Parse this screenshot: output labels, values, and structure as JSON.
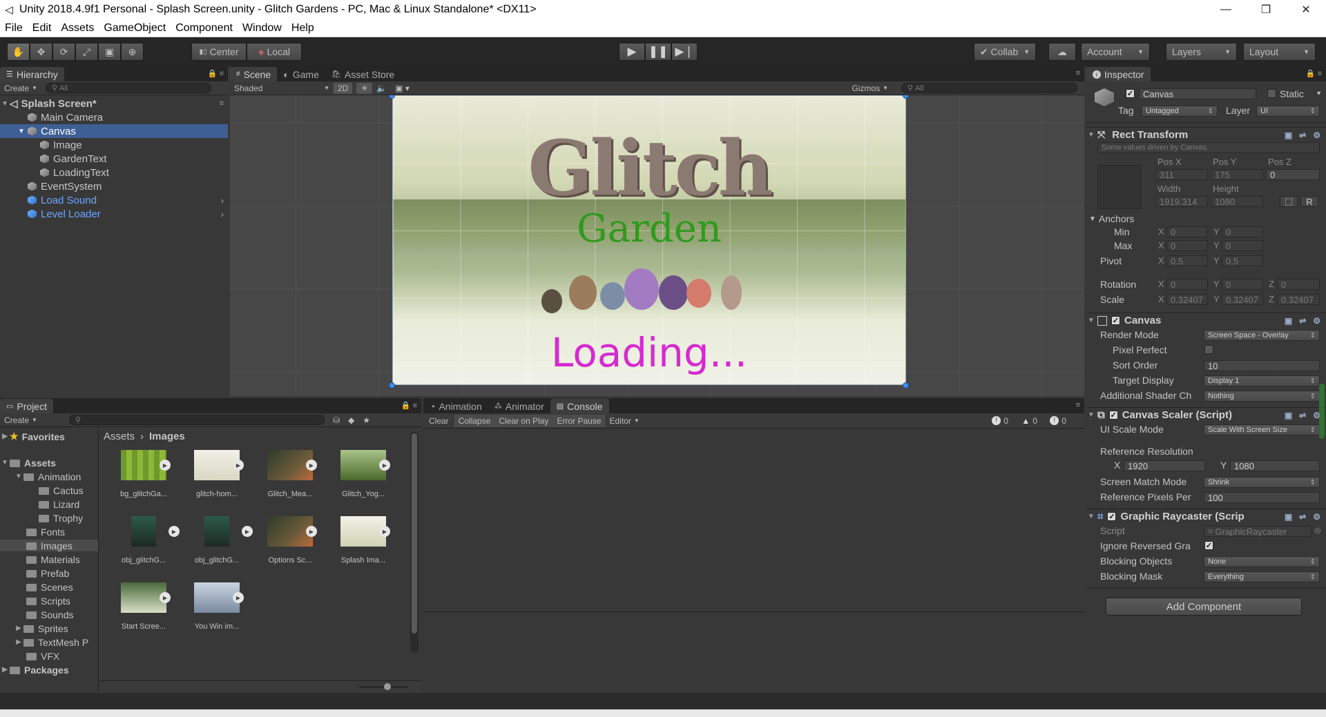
{
  "window": {
    "title": "Unity 2018.4.9f1 Personal - Splash Screen.unity - Glitch Gardens - PC, Mac & Linux Standalone* <DX11>",
    "minimize": "—",
    "restore": "❐",
    "close": "✕"
  },
  "menu": [
    "File",
    "Edit",
    "Assets",
    "GameObject",
    "Component",
    "Window",
    "Help"
  ],
  "toolbar": {
    "pivot": "Center",
    "space": "Local",
    "collab": "Collab",
    "account": "Account",
    "layers": "Layers",
    "layout": "Layout"
  },
  "hierarchy": {
    "tab": "Hierarchy",
    "create": "Create",
    "search_placeholder": "All",
    "scene": "Splash Screen*",
    "items": [
      {
        "label": "Main Camera"
      },
      {
        "label": "Canvas"
      },
      {
        "label": "Image"
      },
      {
        "label": "GardenText"
      },
      {
        "label": "LoadingText"
      },
      {
        "label": "EventSystem"
      },
      {
        "label": "Load Sound"
      },
      {
        "label": "Level Loader"
      }
    ]
  },
  "scene": {
    "tabs": [
      "Scene",
      "Game",
      "Asset Store"
    ],
    "shading": "Shaded",
    "mode_2d": "2D",
    "gizmos": "Gizmos",
    "search_placeholder": "All",
    "game_title": "Glitch",
    "game_subtitle": "Garden",
    "game_loading": "Loading..."
  },
  "project": {
    "tab": "Project",
    "create": "Create",
    "favorites": "Favorites",
    "tree": [
      {
        "label": "Assets"
      },
      {
        "label": "Animation"
      },
      {
        "label": "Cactus"
      },
      {
        "label": "Lizard"
      },
      {
        "label": "Trophy"
      },
      {
        "label": "Fonts"
      },
      {
        "label": "Images"
      },
      {
        "label": "Materials"
      },
      {
        "label": "Prefab"
      },
      {
        "label": "Scenes"
      },
      {
        "label": "Scripts"
      },
      {
        "label": "Sounds"
      },
      {
        "label": "Sprites"
      },
      {
        "label": "TextMesh P"
      },
      {
        "label": "VFX"
      },
      {
        "label": "Packages"
      }
    ],
    "breadcrumb_root": "Assets",
    "breadcrumb_current": "Images",
    "assets": [
      {
        "label": "bg_glitchGa..."
      },
      {
        "label": "glitch-hom..."
      },
      {
        "label": "Glitch_Mea..."
      },
      {
        "label": "Glitch_Yog..."
      },
      {
        "label": "obj_glitchG..."
      },
      {
        "label": "obj_glitchG..."
      },
      {
        "label": "Options Sc..."
      },
      {
        "label": "Splash Ima..."
      },
      {
        "label": "Start Scree..."
      },
      {
        "label": "You Win im..."
      }
    ]
  },
  "console": {
    "tabs": [
      "Animation",
      "Animator",
      "Console"
    ],
    "buttons": [
      "Clear",
      "Collapse",
      "Clear on Play",
      "Error Pause",
      "Editor"
    ],
    "counts": [
      "0",
      "0",
      "0"
    ]
  },
  "inspector": {
    "tab": "Inspector",
    "object_name": "Canvas",
    "static": "Static",
    "tag_label": "Tag",
    "tag": "Untagged",
    "layer_label": "Layer",
    "layer": "UI",
    "rect_transform": {
      "title": "Rect Transform",
      "note": "Some values driven by Canvas.",
      "pos_x_label": "Pos X",
      "pos_y_label": "Pos Y",
      "pos_z_label": "Pos Z",
      "pos_x": "311",
      "pos_y": "175",
      "pos_z": "0",
      "width_label": "Width",
      "height_label": "Height",
      "width": "1919.314",
      "height": "1080",
      "raw_button": "R",
      "anchors": "Anchors",
      "min": "Min",
      "max": "Max",
      "pivot": "Pivot",
      "min_x": "0",
      "min_y": "0",
      "max_x": "0",
      "max_y": "0",
      "pivot_x": "0.5",
      "pivot_y": "0.5",
      "rotation": "Rotation",
      "rot_x": "0",
      "rot_y": "0",
      "rot_z": "0",
      "scale": "Scale",
      "scale_x": "0.32407",
      "scale_y": "0.32407",
      "scale_z": "0.32407",
      "x": "X",
      "y": "Y",
      "z": "Z"
    },
    "canvas": {
      "title": "Canvas",
      "render_mode_label": "Render Mode",
      "render_mode": "Screen Space - Overlay",
      "pixel_perfect_label": "Pixel Perfect",
      "sort_order_label": "Sort Order",
      "sort_order": "10",
      "target_display_label": "Target Display",
      "target_display": "Display 1",
      "shader_label": "Additional Shader Ch",
      "shader": "Nothing"
    },
    "scaler": {
      "title": "Canvas Scaler (Script)",
      "mode_label": "UI Scale Mode",
      "mode": "Scale With Screen Size",
      "ref_res_label": "Reference Resolution",
      "ref_x": "1920",
      "ref_y": "1080",
      "match_label": "Screen Match Mode",
      "match": "Shrink",
      "ppu_label": "Reference Pixels Per",
      "ppu": "100"
    },
    "raycaster": {
      "title": "Graphic Raycaster (Scrip",
      "script_label": "Script",
      "script": "GraphicRaycaster",
      "ignore_label": "Ignore Reversed Gra",
      "blocking_objects_label": "Blocking Objects",
      "blocking_objects": "None",
      "blocking_mask_label": "Blocking Mask",
      "blocking_mask": "Everything"
    },
    "add_component": "Add Component"
  },
  "colors": {
    "selection": "#3e5f96",
    "link_blue": "#6ea6ff",
    "garden_green": "#2f9a1e",
    "loading_magenta": "#d62ad2"
  }
}
